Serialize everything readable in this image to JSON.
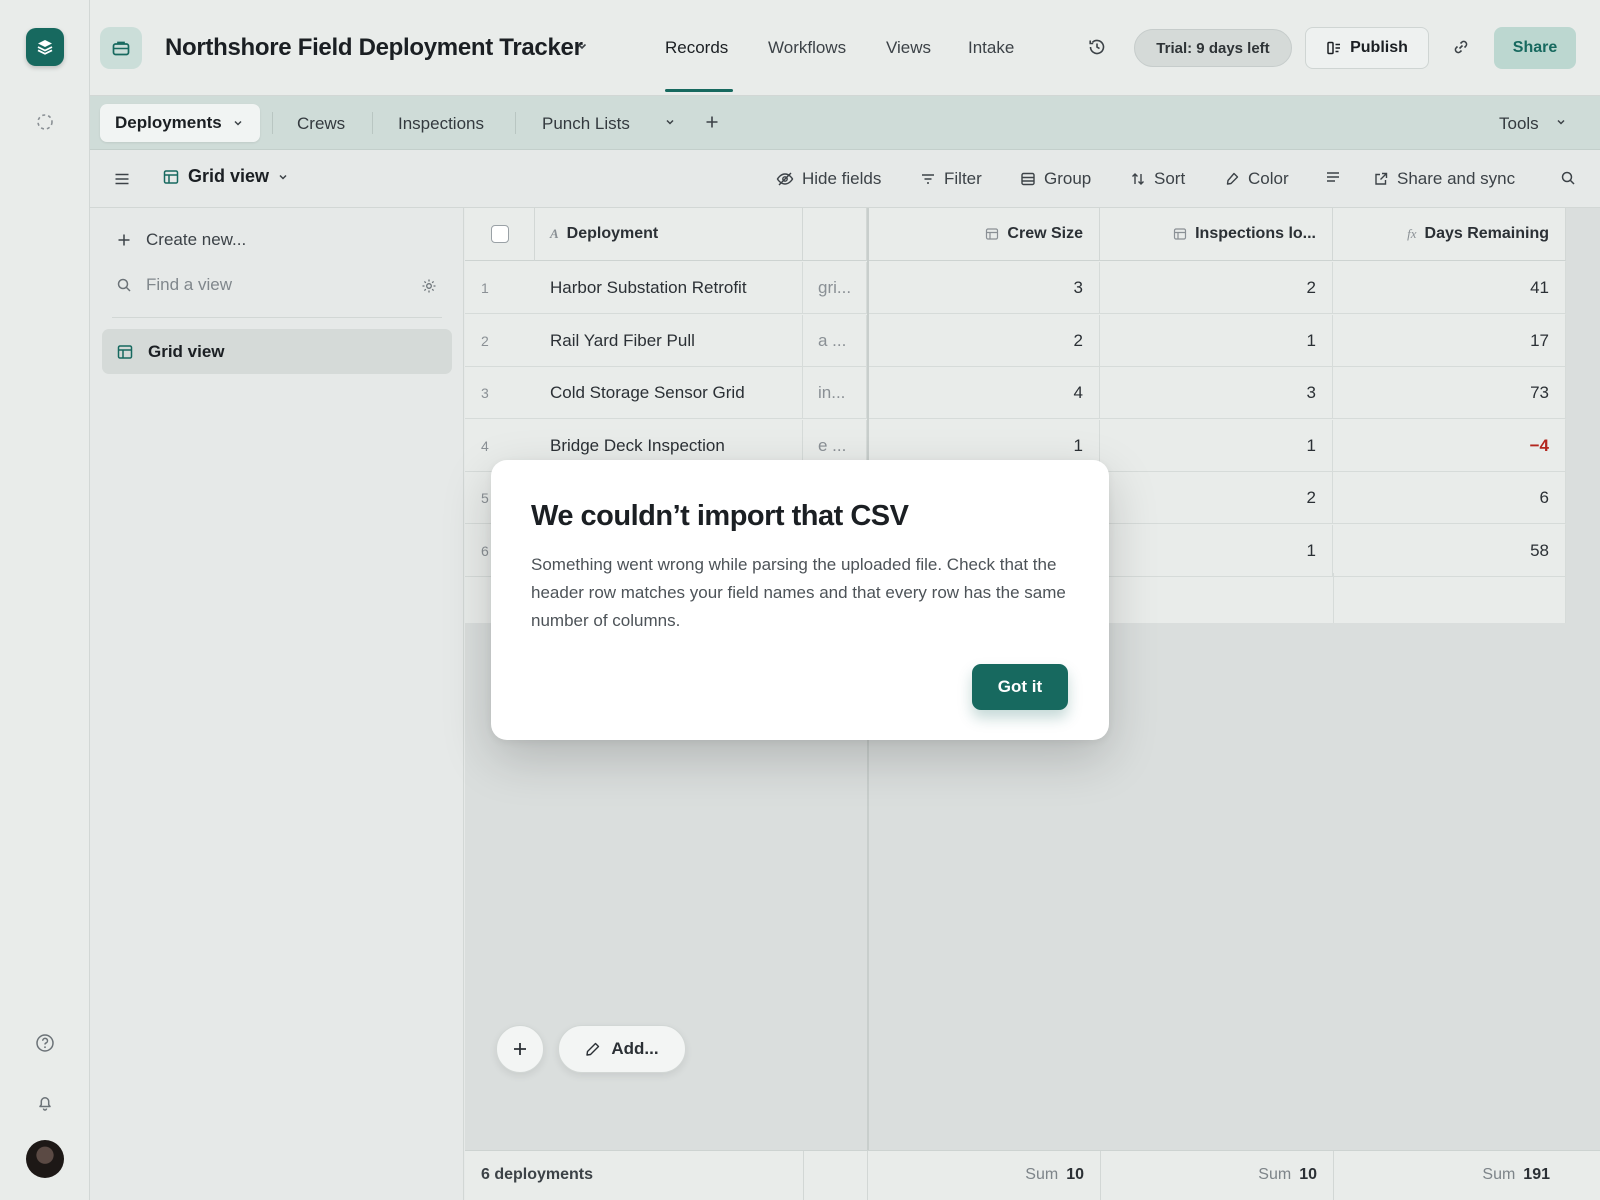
{
  "app": {
    "base_title": "Northshore Field Deployment Tracker",
    "nav_tabs": [
      {
        "label": "Records",
        "active": true
      },
      {
        "label": "Workflows",
        "active": false
      },
      {
        "label": "Views",
        "active": false
      },
      {
        "label": "Intake",
        "active": false
      }
    ],
    "trial_label": "Trial: 9 days left",
    "publish_label": "Publish",
    "share_label": "Share",
    "accent_color": "#17695f"
  },
  "tables": {
    "active": "Deployments",
    "others": [
      "Crews",
      "Inspections",
      "Punch Lists"
    ],
    "tools_label": "Tools"
  },
  "viewbar": {
    "view_name": "Grid view",
    "hide_fields": "Hide fields",
    "filter": "Filter",
    "group": "Group",
    "sort": "Sort",
    "color": "Color",
    "share_sync": "Share and sync"
  },
  "sidebar": {
    "create_new": "Create new...",
    "find_placeholder": "Find a view",
    "views": [
      "Grid view"
    ]
  },
  "grid": {
    "columns": [
      "Deployment",
      "Crew Size",
      "Inspections lo...",
      "Days Remaining"
    ],
    "rows": [
      {
        "n": "1",
        "deployment": "Harbor Substation Retrofit",
        "note": "gri...",
        "crew": "3",
        "insp": "2",
        "days": "41"
      },
      {
        "n": "2",
        "deployment": "Rail Yard Fiber Pull",
        "note": "a ...",
        "crew": "2",
        "insp": "1",
        "days": "17"
      },
      {
        "n": "3",
        "deployment": "Cold Storage Sensor Grid",
        "note": "in...",
        "crew": "4",
        "insp": "3",
        "days": "73"
      },
      {
        "n": "4",
        "deployment": "Bridge Deck Inspection",
        "note": "e ...",
        "crew": "1",
        "insp": "1",
        "days": "−4"
      },
      {
        "n": "5",
        "deployment": "",
        "note": "",
        "crew": "",
        "insp": "2",
        "days": "6"
      },
      {
        "n": "6",
        "deployment": "",
        "note": "",
        "crew": "",
        "insp": "1",
        "days": "58"
      }
    ],
    "negative_color": "#b3261e",
    "footer": {
      "count_label": "6 deployments",
      "sum_label": "Sum",
      "crew_sum": "10",
      "insp_sum": "10",
      "days_sum": "191"
    },
    "add_label": "Add..."
  },
  "modal": {
    "title": "We couldn’t import that CSV",
    "body": "Something went wrong while parsing the uploaded file. Check that the header row matches your field names and that every row has the same number of columns.",
    "ok_label": "Got it"
  }
}
